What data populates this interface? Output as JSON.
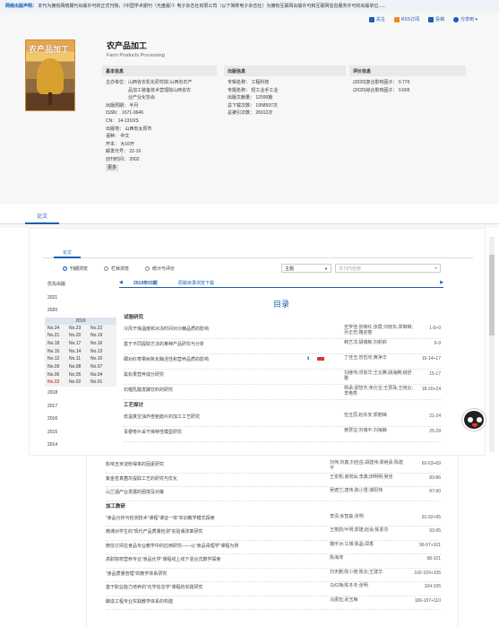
{
  "notice": {
    "heading": "网络出版声明：",
    "text": "本刊为拥有网络期刊出版许可的正式刊物，《中国学术期刊（光盘版）》电子杂志社有限公司（以下简称电子杂志社）为拥有互联网出版许可和互联网信息服务许可的出版单位......"
  },
  "actions": [
    {
      "label": "关注",
      "icon": "plus-icon"
    },
    {
      "label": "RSS订阅",
      "icon": "rss-icon"
    },
    {
      "label": "投稿",
      "icon": "mail-icon"
    },
    {
      "label": "分享到 ▾",
      "icon": "share-icon"
    }
  ],
  "journal": {
    "cover_title": "农产品加工",
    "title": "农产品加工",
    "subtitle": "Farm Products Processing",
    "basic_heading": "基本信息",
    "basic": {
      "sponsor_label": "主办单位：",
      "sponsor_lines": [
        "山西省农机化研究院;山西省农产",
        "品加工装备技术营理院山西省农",
        "业产业化协会"
      ],
      "frequency": "出版周期：  半月",
      "issn": "ISSN：  1671-9646",
      "cn": "CN：  14-1310/S",
      "place": "出版地：  山西省太原市",
      "language": "语种：  中文",
      "format": "开本：  大16开",
      "postcode": "邮发代号：  22-19",
      "founded": "创刊时间：  2002",
      "more": "更多"
    },
    "pub_heading": "出版信息",
    "pub": {
      "focus": "专辑名称：  工程科技",
      "topic": "专题名称：  轻工业手工业",
      "count": "出版文献量：  12599篇",
      "downloads": "总下载次数：  1958597次",
      "cited": "总被引次数：  26912次"
    },
    "eval_heading": "评价信息",
    "eval": {
      "composite": "(2020)复合影响因子：  0.776",
      "comprehensive": "(2020)综合影响因子：  0.605"
    },
    "tab": "论文"
  },
  "issue_browser": {
    "tab": "论文",
    "radios": [
      "刊期浏览",
      "栏目浏览",
      "统计与评价"
    ],
    "selected_radio": 0,
    "select_value": "主题",
    "keyword_placeholder": "本刊内检索",
    "priority": "优先出版",
    "years_before": [
      "2021",
      "2020"
    ],
    "current_year": "2019",
    "issues": [
      "No.24",
      "No.23",
      "No.22",
      "No.21",
      "No.20",
      "No.19",
      "No.18",
      "No.17",
      "No.16",
      "No.15",
      "No.14",
      "No.13",
      "No.12",
      "No.11",
      "No.10",
      "No.09",
      "No.08",
      "No.07",
      "No.06",
      "No.05",
      "No.04",
      "No.03",
      "No.02",
      "No.01"
    ],
    "current_issue": "No.03",
    "years_after": [
      "2018",
      "2017",
      "2016",
      "2015",
      "2014"
    ],
    "issue_label": "2019年03期",
    "download_label": "原版目录浏览下载",
    "toc_title": "目录"
  },
  "toc_upper": [
    {
      "type": "cat",
      "label": "试验研究"
    },
    {
      "title": "冷风干燥温度和冰冻时间对沙棘品质的影响",
      "author": "史罗佳;张锦红;张霞;刘晓东;郑琳琳;孙正忠;魏迎春",
      "pages": "1-5+9"
    },
    {
      "title": "基于不同提取方法的某种产品研究与分析",
      "author": "韩艺洋;胡瑞敏;刘莉莉",
      "pages": "6-9"
    },
    {
      "title": "硒对红枣果树氧化酶活性和营养品质的影响",
      "author": "丁佳玉;曾哲欣;黄净华",
      "pages": "10-14+17",
      "icons": true
    },
    {
      "title": "黑松果营养成分研究",
      "author": "刘继伟;邓俊华;王云腾;胡海腾;姚舒雅",
      "pages": "15-17"
    },
    {
      "title": "石榴乳酸发酵饮料的研究",
      "author": "杨承;梁智杰;朱仕宝;王慧珠;王晓云;李艳秀",
      "pages": "18-20+24"
    },
    {
      "type": "cat",
      "label": "工艺探讨"
    },
    {
      "title": "低温真空油炸杏鲍菇片的加工工艺研究",
      "author": "伍玉荔;赵永安;郭丽梅",
      "pages": "21-24"
    },
    {
      "title": "青梗枣片采干燥特性模型研究",
      "author": "黄慧宝;刘瑞平;刘海静",
      "pages": "25-29"
    }
  ],
  "toc_lower": [
    {
      "title": "影响玉米淀粉得率的因素研究",
      "author": "刘伟;刘鑫;刘佳岳;胡建伟;梁继承;陈建平",
      "pages": "60-63+69"
    },
    {
      "title": "紫金苍真菌灰提取工艺的研究与优化",
      "author": "王安帆;谢岚灿;李鑫;田明明;吴佳",
      "pages": "83-86"
    },
    {
      "title": "山兰酒产业发展的困境及对策",
      "author": "吴德兰;唐伟;陈小雪;谭阳伟",
      "pages": "87-90"
    },
    {
      "type": "cat",
      "label": "加工教研"
    },
    {
      "title": "“食品分析与检测技术”课程“课证一体”实训教学模式探索",
      "author": "李清;余智淼;张明",
      "pages": "91-92+95"
    },
    {
      "title": "微课对学生的“现代产品质量检测”实验课改革研究",
      "author": "王丽鸽;叶明;郭建;赵会;陈素芬",
      "pages": "93-95"
    },
    {
      "title": "微信订阅在食品专业教学中的应用研究——以“食品毒理学”课程为例",
      "author": "魏宇冰;江博;陈晶;郑香",
      "pages": "96-97+101"
    },
    {
      "title": "高职院校营养专业“食品化学”课程线上线下混合式教学探索",
      "author": "陈海涛",
      "pages": "98-101"
    },
    {
      "title": "“食品质量管理”的教学体系研究",
      "author": "刘天鹏;陈小丽;陈云;王建华",
      "pages": "102-103+105"
    },
    {
      "title": "基于职业能力培养的“化学信息学”课程的实践研究",
      "author": "马红梅;陈冬冬;张明",
      "pages": "104-105"
    },
    {
      "title": "酿造工程专业实践教学体系的构建",
      "author": "马振伍;武玉梅",
      "pages": "106-107+110"
    }
  ]
}
